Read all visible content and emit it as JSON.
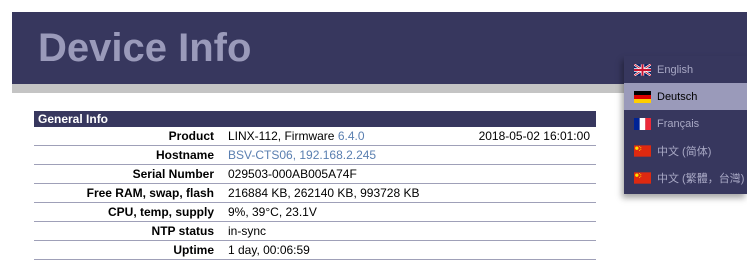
{
  "header": {
    "title": "Device Info"
  },
  "general_info": {
    "section_title": "General Info",
    "rows": [
      {
        "label": "Product",
        "value": "LINX-112, Firmware ",
        "link": "6.4.0",
        "date": "2018-05-02 16:01:00"
      },
      {
        "label": "Hostname",
        "link": "BSV-CTS06, 192.168.2.245"
      },
      {
        "label": "Serial Number",
        "value": "029503-000AB005A74F"
      },
      {
        "label": "Free RAM, swap, flash",
        "value": "216884 KB, 262140 KB, 993728 KB"
      },
      {
        "label": "CPU, temp, supply",
        "value": "9%, 39°C, 23.1V"
      },
      {
        "label": "NTP status",
        "value": "in-sync"
      },
      {
        "label": "Uptime",
        "value": "1 day, 00:06:59"
      }
    ]
  },
  "language_menu": {
    "items": [
      {
        "label": "English",
        "flag": "uk-flag-icon"
      },
      {
        "label": "Deutsch",
        "flag": "germany-flag-icon",
        "active": true
      },
      {
        "label": "Français",
        "flag": "france-flag-icon"
      },
      {
        "label": "中文 (简体)",
        "flag": "china-flag-icon"
      },
      {
        "label": "中文 (繁體，台灣)",
        "flag": "china-flag-icon"
      }
    ]
  },
  "colors": {
    "header_bg": "#37375e",
    "title": "#9a9aba",
    "link": "#5a7fb0",
    "active_item_bg": "#9a9aba"
  }
}
